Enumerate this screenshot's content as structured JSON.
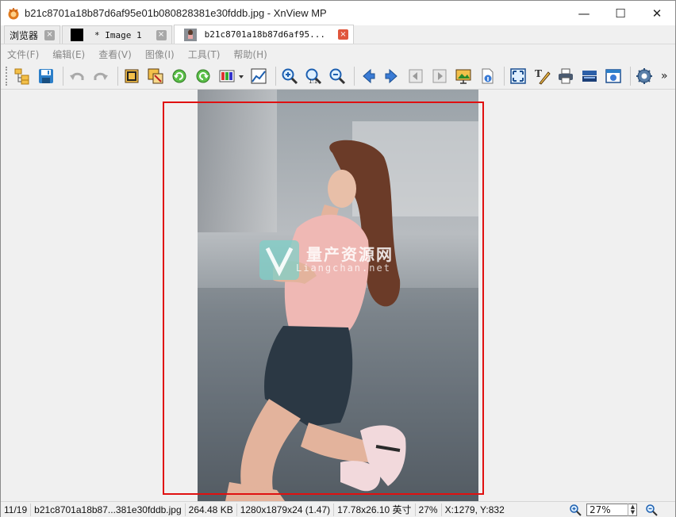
{
  "window": {
    "title": "b21c8701a18b87d6af95e01b080828381e30fddb.jpg - XnView MP",
    "minimize": "—",
    "maximize": "☐",
    "close": "✕"
  },
  "tabs": [
    {
      "label": "浏览器",
      "close": "×"
    },
    {
      "label": "* Image 1",
      "close": "×"
    },
    {
      "label": "b21c8701a18b87d6af95...",
      "close": "×"
    }
  ],
  "menu": [
    "文件(F)",
    "编辑(E)",
    "查看(V)",
    "图像(I)",
    "工具(T)",
    "帮助(H)"
  ],
  "toolbar": {
    "overflow": "»",
    "icons": [
      "browser-icon",
      "save-icon",
      "undo-icon",
      "redo-icon",
      "crop-icon",
      "resize-icon",
      "rotate-left-icon",
      "rotate-right-icon",
      "color-adjust-icon",
      "dropdown-arrow-icon",
      "levels-icon",
      "zoom-in-icon",
      "zoom-actual-icon",
      "zoom-out-icon",
      "previous-icon",
      "next-icon",
      "first-icon",
      "last-icon",
      "slideshow-icon",
      "info-icon",
      "fullscreen-icon",
      "edit-text-icon",
      "print-icon",
      "scan-icon",
      "capture-icon",
      "settings-icon"
    ]
  },
  "watermark": {
    "title": "量产资源网",
    "subtitle": "Liangchan.net"
  },
  "statusbar": {
    "index": "11/19",
    "filename": "b21c8701a18b87...381e30fddb.jpg",
    "filesize": "264.48 KB",
    "dimensions": "1280x1879x24 (1.47)",
    "print_size": "17.78x26.10 英寸",
    "zoom_percent": "27%",
    "cursor": "X:1279, Y:832",
    "zoom_value": "27%"
  },
  "colors": {
    "selection": "#e01010",
    "accent_close": "#e0563c"
  }
}
